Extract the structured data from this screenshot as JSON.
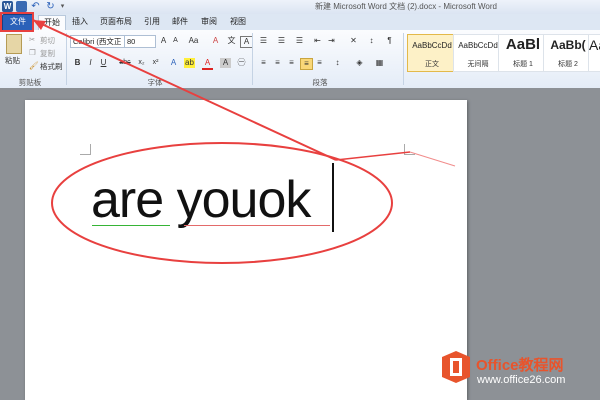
{
  "window": {
    "title": "新建 Microsoft Word 文档 (2).docx - Microsoft Word",
    "quick_access": [
      "word-app-icon",
      "save-icon",
      "undo-icon",
      "redo-icon",
      "customize-qat-icon"
    ]
  },
  "tabs": [
    "文件",
    "开始",
    "插入",
    "页面布局",
    "引用",
    "邮件",
    "审阅",
    "视图"
  ],
  "clipboard": {
    "paste": "粘贴",
    "cut": "剪切",
    "copy": "复制",
    "format_painter": "格式刷",
    "group_label": "剪贴板"
  },
  "font": {
    "name": "Calibri (西文正",
    "size": "80",
    "group_label": "字体",
    "buttons": [
      "B",
      "I",
      "U",
      "abc",
      "x₂",
      "x²"
    ]
  },
  "paragraph": {
    "group_label": "段落"
  },
  "styles": [
    {
      "preview": "AaBbCcDd",
      "name": "正文",
      "selected": true
    },
    {
      "preview": "AaBbCcDd",
      "name": "无间隔",
      "selected": false
    },
    {
      "preview": "AaBl",
      "name": "标题 1",
      "selected": false
    },
    {
      "preview": "AaBb(",
      "name": "标题 2",
      "selected": false
    },
    {
      "preview": "Aa",
      "name": "",
      "selected": false
    }
  ],
  "document": {
    "text": "are youok"
  },
  "watermark": {
    "brand": "Office教程网",
    "url": "www.office26.com"
  },
  "colors": {
    "file_tab": "#2b61b9",
    "annotation": "#e8403f",
    "watermark_orange": "#e8542c"
  }
}
